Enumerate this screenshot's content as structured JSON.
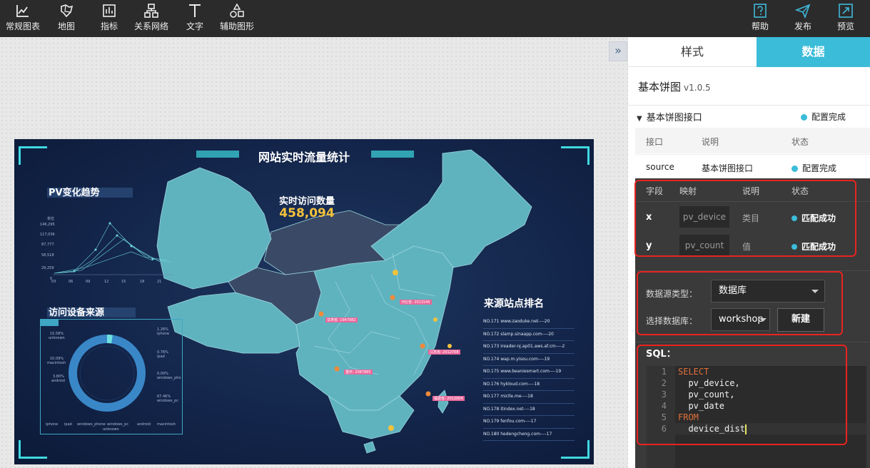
{
  "toolbar": {
    "left_tools": [
      {
        "label": "常规图表",
        "icon": "line-chart-icon"
      },
      {
        "label": "地图",
        "icon": "map-icon"
      },
      {
        "label": "指标",
        "icon": "indicator-icon"
      },
      {
        "label": "关系网络",
        "icon": "network-icon"
      },
      {
        "label": "文字",
        "icon": "text-icon"
      },
      {
        "label": "辅助图形",
        "icon": "shapes-icon"
      }
    ],
    "right_tools": [
      {
        "label": "帮助",
        "icon": "help-icon"
      },
      {
        "label": "发布",
        "icon": "publish-icon"
      },
      {
        "label": "预览",
        "icon": "preview-icon"
      }
    ]
  },
  "dashboard": {
    "title": "网站实时流量统计",
    "pv_title": "PV变化趋势",
    "device_title": "访问设备来源",
    "realtime_label": "实时访问数量",
    "realtime_value": "458,094",
    "rank_title": "来源站点排名",
    "pv_axis": {
      "y_label": "单位",
      "y_ticks": [
        "146,295",
        "117,036",
        "87,777",
        "58,518",
        "29,259",
        "0"
      ],
      "x_ticks": [
        "03",
        "06",
        "09",
        "12",
        "15",
        "18",
        "21"
      ]
    },
    "device_labels": [
      {
        "pct": "15.58%",
        "name": "unknown"
      },
      {
        "pct": "10.09%",
        "name": "macintosh"
      },
      {
        "pct": "3.80%",
        "name": "android"
      },
      {
        "pct": "1.26%",
        "name": "iphone"
      },
      {
        "pct": "0.76%",
        "name": "ipad"
      },
      {
        "pct": "0.00%",
        "name": "windows_pho"
      },
      {
        "pct": "67.46%",
        "name": "windows_pc"
      }
    ],
    "device_legend": [
      "iphone",
      "ipad",
      "windows_phone",
      "windows_pc",
      "android",
      "macintosh",
      "unknown"
    ],
    "map_tags": [
      "甘肃省: 1947082",
      "河北省: 2011545",
      "江苏省: 2012708",
      "重庆: 2087885",
      "福建省: 2012004"
    ],
    "rank_rows": [
      "NO.171  www.zaoduke.net----20",
      "NO.172  slamp.sinaapp.com----20",
      "NO.173  ireader-nj.ap01.aws.af.cm----2",
      "NO.174  wap.m.yisou.com----19",
      "NO.175  www.beaniesmart.com----19",
      "NO.176  hykloud.com----18",
      "NO.177  miclle.me----18",
      "NO.178  itindex.net----18",
      "NO.179  fenfou.com----17",
      "NO.180  hedengcheng.com----17"
    ]
  },
  "panel": {
    "tab_style": "样式",
    "tab_data": "数据",
    "component_name": "基本饼图",
    "component_version": "v1.0.5",
    "interface_section": "基本饼图接口",
    "interface_status": "配置完成",
    "iface_headers": {
      "col1": "接口",
      "col2": "说明",
      "col3": "状态"
    },
    "iface_row": {
      "name": "source",
      "desc": "基本饼图接口",
      "status": "配置完成"
    },
    "field_headers": {
      "col1": "字段",
      "col2": "映射",
      "col3": "说明",
      "col4": "状态"
    },
    "fields": [
      {
        "key": "x",
        "mapping": "pv_device",
        "desc": "类目",
        "status": "匹配成功"
      },
      {
        "key": "y",
        "mapping": "pv_count",
        "desc": "值",
        "status": "匹配成功"
      }
    ],
    "datasource_type_label": "数据源类型：",
    "datasource_type_value": "数据库",
    "database_label": "选择数据库：",
    "database_value": "workshop",
    "new_button": "新建",
    "sql_label": "SQL：",
    "sql_lines": [
      {
        "num": "1",
        "text": "SELECT",
        "kind": "kw"
      },
      {
        "num": "2",
        "text": "  pv_device,",
        "kind": "id"
      },
      {
        "num": "3",
        "text": "  pv_count,",
        "kind": "id"
      },
      {
        "num": "4",
        "text": "  pv_date",
        "kind": "id"
      },
      {
        "num": "5",
        "text": "FROM",
        "kind": "kw"
      },
      {
        "num": "6",
        "text": "  device_dist",
        "kind": "id"
      }
    ],
    "colors": {
      "accent": "#3bbcd8",
      "highlight_border": "#e8231f",
      "sql_keyword": "#e0703a"
    }
  }
}
